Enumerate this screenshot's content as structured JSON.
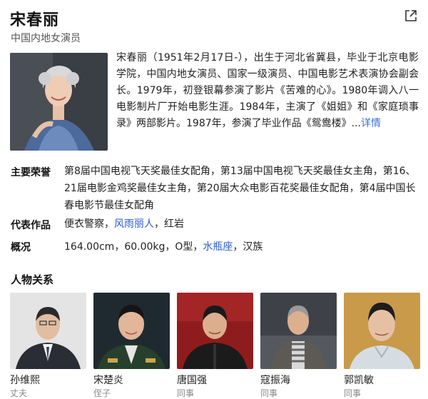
{
  "header": {
    "name": "宋春丽",
    "occupation": "中国内地女演员",
    "share_icon": "share-external-icon"
  },
  "intro": {
    "text": "宋春丽（1951年2月17日-），出生于河北省冀县，毕业于北京电影学院，中国内地女演员、国家一级演员、中国电影艺术表演协会副会长。1979年，初登银幕参演了影片《苦难的心》。1980年调入八一电影制片厂开始电影生涯。1984年，主演了《姐姐》和《家庭琐事录》两部影片。1987年，参演了毕业作品《鸳鸯楼》...",
    "more_label": "详情"
  },
  "facts": {
    "honors_label": "主要荣誉",
    "honors_text": "第8届中国电视飞天奖最佳女配角，第13届中国电视飞天奖最佳女主角，第16、21届电影金鸡奖最佳女主角，第20届大众电影百花奖最佳女配角，第4届中国长春电影节最佳女配角",
    "works_label": "代表作品",
    "works": {
      "item1": "便衣警察",
      "sep1": "，",
      "item2": "风雨丽人",
      "sep2": "，",
      "item3": "红岩"
    },
    "profile_label": "概况",
    "profile": {
      "part1": "164.00cm，60.00kg，O型，",
      "zodiac": "水瓶座",
      "part2": "，汉族"
    }
  },
  "relations": {
    "title": "人物关系",
    "people": [
      {
        "name": "孙维熙",
        "relation": "丈夫"
      },
      {
        "name": "宋楚炎",
        "relation": "侄子"
      },
      {
        "name": "唐国强",
        "relation": "同事"
      },
      {
        "name": "寇振海",
        "relation": "同事"
      },
      {
        "name": "郭凯敏",
        "relation": "同事"
      }
    ]
  },
  "colors": {
    "link": "#2a5bd2",
    "more": "#3b6fd8"
  }
}
